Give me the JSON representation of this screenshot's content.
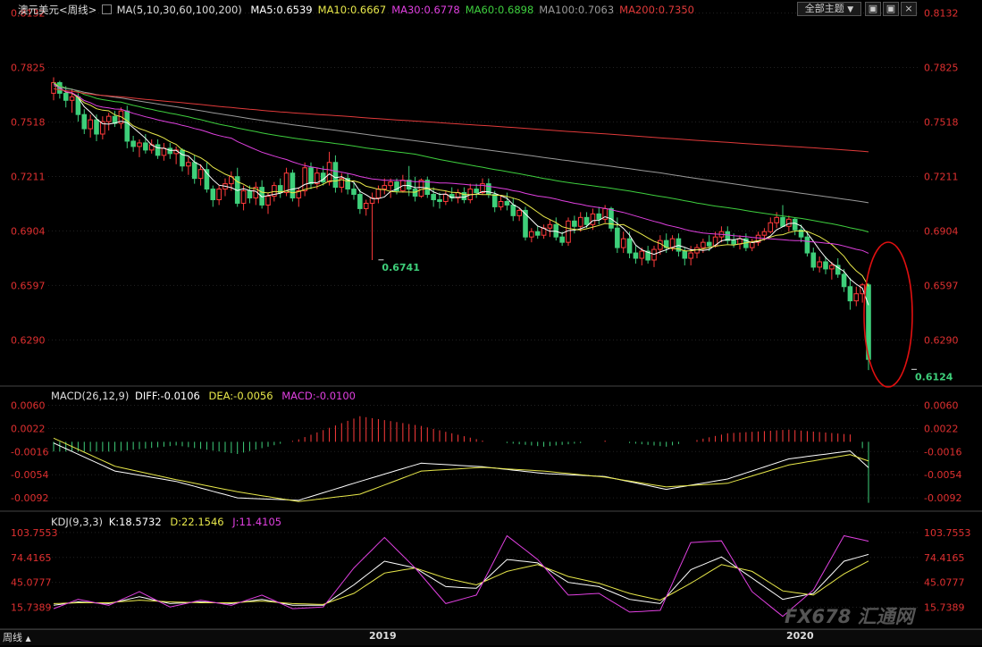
{
  "header": {
    "symbol": "澳元美元<周线>",
    "ma_params": "MA(5,10,30,60,100,200)",
    "ma_values": [
      {
        "label": "MA5:0.6539",
        "color": "#ffffff"
      },
      {
        "label": "MA10:0.6667",
        "color": "#e8e84a"
      },
      {
        "label": "MA30:0.6778",
        "color": "#e040e0"
      },
      {
        "label": "MA60:0.6898",
        "color": "#3ecf3e"
      },
      {
        "label": "MA100:0.7063",
        "color": "#9a9a9a"
      },
      {
        "label": "MA200:0.7350",
        "color": "#e03a3a"
      }
    ],
    "theme_button": "全部主题",
    "theme_arrow": "▼"
  },
  "macd_header": {
    "name": "MACD(26,12,9)",
    "diff": "DIFF:-0.0106",
    "dea": "DEA:-0.0056",
    "macd": "MACD:-0.0100"
  },
  "kdj_header": {
    "name": "KDJ(9,3,3)",
    "k": "K:18.5732",
    "d": "D:22.1546",
    "j": "J:11.4105"
  },
  "bottom": {
    "period": "周线",
    "x_labels": [
      "2019",
      "2020"
    ],
    "watermark": "FX678 汇通网"
  },
  "colors": {
    "up": "#ff3b3b",
    "down": "#3ecf7a",
    "axis": "#e03030",
    "ma5": "#ffffff",
    "ma10": "#e8e84a",
    "ma30": "#e040e0",
    "ma60": "#3ecf3e",
    "ma100": "#9a9a9a",
    "ma200": "#e03a3a",
    "annotation_circle": "#e01010"
  },
  "chart_data": [
    {
      "type": "candlestick",
      "title": "澳元美元<周线>",
      "y_ticks": [
        0.8132,
        0.7825,
        0.7518,
        0.7211,
        0.6904,
        0.6597,
        0.629
      ],
      "ylim": [
        0.605,
        0.8135
      ],
      "annotations": [
        {
          "label": "0.6741",
          "value": 0.6741,
          "index": 53
        },
        {
          "label": "0.6124",
          "value": 0.6124,
          "index": 140
        }
      ],
      "ma_last": {
        "MA5": 0.6539,
        "MA10": 0.6667,
        "MA30": 0.6778,
        "MA60": 0.6898,
        "MA100": 0.7063,
        "MA200": 0.735
      },
      "ohlc": [
        [
          0.768,
          0.777,
          0.764,
          0.774
        ],
        [
          0.774,
          0.775,
          0.765,
          0.768
        ],
        [
          0.768,
          0.772,
          0.76,
          0.764
        ],
        [
          0.764,
          0.77,
          0.757,
          0.766
        ],
        [
          0.766,
          0.768,
          0.752,
          0.756
        ],
        [
          0.756,
          0.759,
          0.745,
          0.748
        ],
        [
          0.748,
          0.756,
          0.743,
          0.753
        ],
        [
          0.753,
          0.756,
          0.741,
          0.745
        ],
        [
          0.745,
          0.755,
          0.742,
          0.752
        ],
        [
          0.752,
          0.757,
          0.747,
          0.755
        ],
        [
          0.755,
          0.758,
          0.749,
          0.751
        ],
        [
          0.751,
          0.76,
          0.748,
          0.758
        ],
        [
          0.758,
          0.761,
          0.737,
          0.741
        ],
        [
          0.741,
          0.744,
          0.735,
          0.738
        ],
        [
          0.738,
          0.742,
          0.732,
          0.74
        ],
        [
          0.74,
          0.745,
          0.734,
          0.736
        ],
        [
          0.736,
          0.742,
          0.734,
          0.739
        ],
        [
          0.739,
          0.742,
          0.731,
          0.733
        ],
        [
          0.733,
          0.74,
          0.73,
          0.737
        ],
        [
          0.737,
          0.74,
          0.731,
          0.734
        ],
        [
          0.734,
          0.738,
          0.728,
          0.736
        ],
        [
          0.736,
          0.737,
          0.724,
          0.727
        ],
        [
          0.727,
          0.732,
          0.722,
          0.729
        ],
        [
          0.729,
          0.733,
          0.717,
          0.72
        ],
        [
          0.72,
          0.728,
          0.716,
          0.725
        ],
        [
          0.725,
          0.729,
          0.712,
          0.714
        ],
        [
          0.714,
          0.716,
          0.704,
          0.708
        ],
        [
          0.708,
          0.716,
          0.705,
          0.714
        ],
        [
          0.714,
          0.72,
          0.71,
          0.717
        ],
        [
          0.717,
          0.724,
          0.713,
          0.721
        ],
        [
          0.721,
          0.726,
          0.704,
          0.706
        ],
        [
          0.706,
          0.716,
          0.702,
          0.713
        ],
        [
          0.713,
          0.716,
          0.706,
          0.709
        ],
        [
          0.709,
          0.718,
          0.705,
          0.715
        ],
        [
          0.715,
          0.719,
          0.703,
          0.705
        ],
        [
          0.705,
          0.712,
          0.7,
          0.71
        ],
        [
          0.71,
          0.718,
          0.707,
          0.716
        ],
        [
          0.716,
          0.72,
          0.709,
          0.712
        ],
        [
          0.712,
          0.726,
          0.71,
          0.723
        ],
        [
          0.723,
          0.725,
          0.707,
          0.709
        ],
        [
          0.709,
          0.715,
          0.704,
          0.713
        ],
        [
          0.713,
          0.729,
          0.71,
          0.726
        ],
        [
          0.726,
          0.729,
          0.714,
          0.717
        ],
        [
          0.717,
          0.726,
          0.714,
          0.723
        ],
        [
          0.723,
          0.727,
          0.716,
          0.718
        ],
        [
          0.718,
          0.735,
          0.716,
          0.729
        ],
        [
          0.729,
          0.733,
          0.712,
          0.715
        ],
        [
          0.715,
          0.723,
          0.712,
          0.72
        ],
        [
          0.72,
          0.723,
          0.711,
          0.714
        ],
        [
          0.714,
          0.718,
          0.708,
          0.711
        ],
        [
          0.711,
          0.714,
          0.7,
          0.703
        ],
        [
          0.703,
          0.708,
          0.699,
          0.706
        ],
        [
          0.706,
          0.712,
          0.674,
          0.709
        ],
        [
          0.709,
          0.716,
          0.706,
          0.714
        ],
        [
          0.714,
          0.72,
          0.711,
          0.716
        ],
        [
          0.716,
          0.72,
          0.709,
          0.718
        ],
        [
          0.718,
          0.72,
          0.711,
          0.713
        ],
        [
          0.713,
          0.722,
          0.712,
          0.719
        ],
        [
          0.719,
          0.727,
          0.71,
          0.714
        ],
        [
          0.714,
          0.721,
          0.707,
          0.71
        ],
        [
          0.71,
          0.72,
          0.709,
          0.719
        ],
        [
          0.719,
          0.721,
          0.709,
          0.711
        ],
        [
          0.711,
          0.715,
          0.704,
          0.708
        ],
        [
          0.708,
          0.712,
          0.703,
          0.707
        ],
        [
          0.707,
          0.713,
          0.705,
          0.711
        ],
        [
          0.711,
          0.715,
          0.707,
          0.709
        ],
        [
          0.709,
          0.714,
          0.706,
          0.712
        ],
        [
          0.712,
          0.715,
          0.706,
          0.708
        ],
        [
          0.708,
          0.717,
          0.706,
          0.714
        ],
        [
          0.714,
          0.717,
          0.709,
          0.712
        ],
        [
          0.712,
          0.72,
          0.711,
          0.717
        ],
        [
          0.717,
          0.72,
          0.709,
          0.711
        ],
        [
          0.711,
          0.713,
          0.701,
          0.704
        ],
        [
          0.704,
          0.71,
          0.702,
          0.707
        ],
        [
          0.707,
          0.712,
          0.702,
          0.705
        ],
        [
          0.705,
          0.709,
          0.696,
          0.699
        ],
        [
          0.699,
          0.703,
          0.696,
          0.702
        ],
        [
          0.702,
          0.704,
          0.685,
          0.687
        ],
        [
          0.687,
          0.692,
          0.684,
          0.69
        ],
        [
          0.69,
          0.693,
          0.686,
          0.688
        ],
        [
          0.688,
          0.694,
          0.686,
          0.692
        ],
        [
          0.692,
          0.697,
          0.687,
          0.694
        ],
        [
          0.694,
          0.698,
          0.685,
          0.687
        ],
        [
          0.687,
          0.69,
          0.682,
          0.684
        ],
        [
          0.684,
          0.698,
          0.682,
          0.696
        ],
        [
          0.696,
          0.699,
          0.689,
          0.693
        ],
        [
          0.693,
          0.701,
          0.69,
          0.698
        ],
        [
          0.698,
          0.701,
          0.692,
          0.694
        ],
        [
          0.694,
          0.703,
          0.691,
          0.7
        ],
        [
          0.7,
          0.704,
          0.694,
          0.697
        ],
        [
          0.697,
          0.705,
          0.695,
          0.703
        ],
        [
          0.703,
          0.704,
          0.69,
          0.692
        ],
        [
          0.692,
          0.698,
          0.678,
          0.681
        ],
        [
          0.681,
          0.69,
          0.678,
          0.686
        ],
        [
          0.686,
          0.69,
          0.675,
          0.678
        ],
        [
          0.678,
          0.682,
          0.672,
          0.675
        ],
        [
          0.675,
          0.681,
          0.671,
          0.679
        ],
        [
          0.679,
          0.682,
          0.672,
          0.674
        ],
        [
          0.674,
          0.682,
          0.67,
          0.68
        ],
        [
          0.68,
          0.688,
          0.677,
          0.685
        ],
        [
          0.685,
          0.689,
          0.678,
          0.681
        ],
        [
          0.681,
          0.688,
          0.679,
          0.686
        ],
        [
          0.686,
          0.689,
          0.676,
          0.679
        ],
        [
          0.679,
          0.681,
          0.671,
          0.675
        ],
        [
          0.675,
          0.682,
          0.671,
          0.678
        ],
        [
          0.678,
          0.683,
          0.675,
          0.681
        ],
        [
          0.681,
          0.686,
          0.678,
          0.684
        ],
        [
          0.684,
          0.688,
          0.679,
          0.682
        ],
        [
          0.682,
          0.69,
          0.681,
          0.687
        ],
        [
          0.687,
          0.693,
          0.684,
          0.69
        ],
        [
          0.69,
          0.693,
          0.683,
          0.685
        ],
        [
          0.685,
          0.689,
          0.681,
          0.683
        ],
        [
          0.683,
          0.688,
          0.68,
          0.686
        ],
        [
          0.686,
          0.689,
          0.679,
          0.681
        ],
        [
          0.681,
          0.686,
          0.679,
          0.684
        ],
        [
          0.684,
          0.69,
          0.682,
          0.688
        ],
        [
          0.688,
          0.692,
          0.685,
          0.69
        ],
        [
          0.69,
          0.698,
          0.689,
          0.695
        ],
        [
          0.695,
          0.701,
          0.692,
          0.698
        ],
        [
          0.698,
          0.705,
          0.694,
          0.693
        ],
        [
          0.693,
          0.699,
          0.69,
          0.697
        ],
        [
          0.697,
          0.698,
          0.688,
          0.691
        ],
        [
          0.691,
          0.694,
          0.684,
          0.687
        ],
        [
          0.687,
          0.69,
          0.676,
          0.678
        ],
        [
          0.678,
          0.681,
          0.668,
          0.67
        ],
        [
          0.67,
          0.676,
          0.667,
          0.673
        ],
        [
          0.673,
          0.676,
          0.666,
          0.669
        ],
        [
          0.669,
          0.673,
          0.663,
          0.671
        ],
        [
          0.671,
          0.675,
          0.664,
          0.666
        ],
        [
          0.666,
          0.669,
          0.656,
          0.659
        ],
        [
          0.659,
          0.664,
          0.646,
          0.651
        ],
        [
          0.651,
          0.659,
          0.648,
          0.655
        ],
        [
          0.655,
          0.661,
          0.65,
          0.66
        ],
        [
          0.66,
          0.661,
          0.612,
          0.618
        ]
      ]
    },
    {
      "type": "macd",
      "title": "MACD(26,12,9)",
      "y_ticks": [
        0.006,
        0.0022,
        -0.0016,
        -0.0054,
        -0.0092
      ],
      "ylim": [
        -0.0105,
        0.0068
      ],
      "last": {
        "DIFF": -0.0106,
        "DEA": -0.0056,
        "MACD": -0.01
      },
      "series": [
        {
          "name": "DIFF",
          "x": [
            0,
            10,
            20,
            30,
            40,
            50,
            60,
            70,
            80,
            90,
            100,
            110,
            120,
            130,
            140
          ],
          "values": [
            -0.0002,
            -0.0048,
            -0.0065,
            -0.0092,
            -0.0096,
            -0.0065,
            -0.0035,
            -0.0041,
            -0.0052,
            -0.0057,
            -0.0078,
            -0.0061,
            -0.0028,
            -0.0015,
            -0.0106
          ]
        },
        {
          "name": "DEA",
          "x": [
            0,
            10,
            20,
            30,
            40,
            50,
            60,
            70,
            80,
            90,
            100,
            110,
            120,
            130,
            140
          ],
          "values": [
            0.0006,
            -0.004,
            -0.0062,
            -0.0082,
            -0.0098,
            -0.0086,
            -0.0048,
            -0.0042,
            -0.0048,
            -0.0058,
            -0.0074,
            -0.0068,
            -0.0038,
            -0.0021,
            -0.0056
          ]
        }
      ]
    },
    {
      "type": "line",
      "title": "KDJ(9,3,3)",
      "y_ticks": [
        103.7553,
        74.4165,
        45.0777,
        15.7389
      ],
      "ylim": [
        -8,
        110
      ],
      "last": {
        "K": 18.5732,
        "D": 22.1546,
        "J": 11.4105
      },
      "series": [
        {
          "name": "K",
          "x": [
            0,
            4,
            9,
            14,
            19,
            24,
            29,
            34,
            39,
            44,
            49,
            54,
            59,
            64,
            69,
            74,
            79,
            84,
            89,
            94,
            99,
            104,
            109,
            114,
            119,
            124,
            129,
            134,
            139,
            140
          ],
          "values": [
            18,
            22,
            20,
            28,
            20,
            22,
            20,
            25,
            18,
            18,
            42,
            70,
            62,
            40,
            38,
            72,
            68,
            45,
            40,
            25,
            20,
            60,
            75,
            50,
            25,
            32,
            70,
            80,
            55,
            18.57
          ]
        },
        {
          "name": "D",
          "x": [
            0,
            4,
            9,
            14,
            19,
            24,
            29,
            34,
            39,
            44,
            49,
            54,
            59,
            64,
            69,
            74,
            79,
            84,
            89,
            94,
            99,
            104,
            109,
            114,
            119,
            124,
            129,
            134,
            139,
            140
          ],
          "values": [
            20,
            21,
            21,
            24,
            22,
            21,
            21,
            23,
            20,
            19,
            32,
            56,
            62,
            50,
            42,
            58,
            66,
            52,
            44,
            32,
            24,
            44,
            66,
            58,
            35,
            30,
            55,
            74,
            60,
            22.15
          ]
        },
        {
          "name": "J",
          "x": [
            0,
            4,
            9,
            14,
            19,
            24,
            29,
            34,
            39,
            44,
            49,
            54,
            59,
            64,
            69,
            74,
            79,
            84,
            89,
            94,
            99,
            104,
            109,
            114,
            119,
            124,
            129,
            134,
            139,
            140
          ],
          "values": [
            14,
            25,
            18,
            34,
            16,
            24,
            18,
            30,
            14,
            16,
            62,
            98,
            62,
            20,
            30,
            100,
            72,
            30,
            32,
            10,
            12,
            92,
            94,
            34,
            5,
            36,
            100,
            92,
            45,
            11.41
          ]
        }
      ]
    }
  ]
}
